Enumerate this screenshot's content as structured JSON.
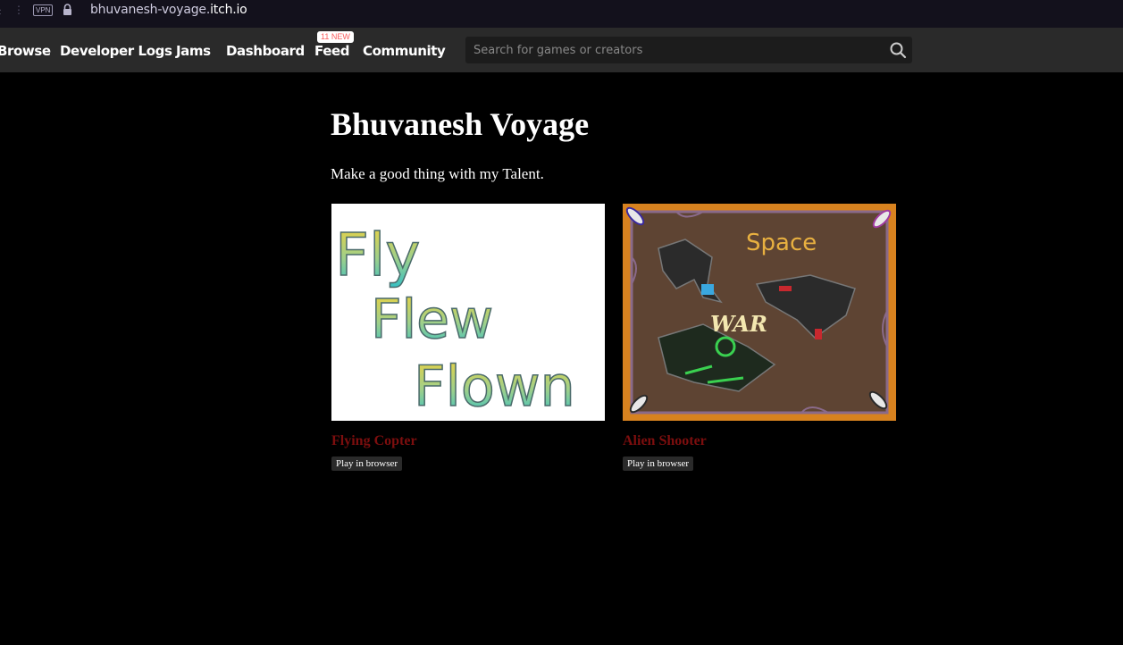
{
  "browser": {
    "vpn_label": "VPN",
    "url_prefix": "bhuvanesh-voyage.",
    "url_domain": "itch.io"
  },
  "nav": {
    "items": [
      "Browse",
      "Developer Logs",
      "Jams",
      "Dashboard",
      "Feed",
      "Community"
    ],
    "feed_badge": "11 NEW",
    "search_placeholder": "Search for games or creators"
  },
  "page": {
    "title": "Bhuvanesh Voyage",
    "description": "Make a good thing with my Talent."
  },
  "games": [
    {
      "title": "Flying Copter",
      "tag": "Play in browser",
      "cover_text": [
        "Fly",
        "Flew",
        "Flown"
      ]
    },
    {
      "title": "Alien Shooter",
      "tag": "Play in browser",
      "cover_text": [
        "Space",
        "WAR"
      ]
    }
  ],
  "colors": {
    "game_title": "#7c0e0e",
    "header_bg": "#2a2a2a",
    "badge_text": "#fa5c5c"
  }
}
